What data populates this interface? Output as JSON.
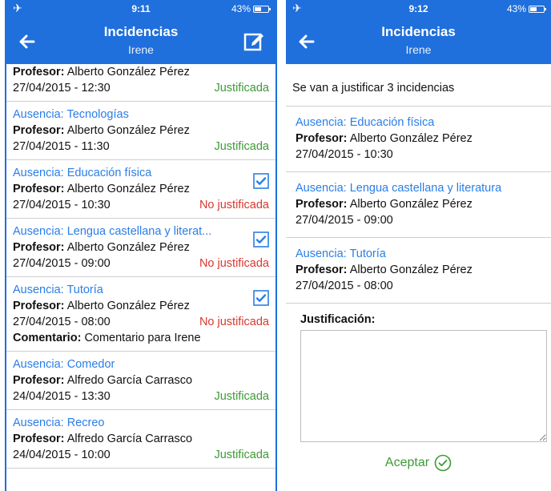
{
  "left": {
    "status": {
      "time": "9:11",
      "battery": "43%"
    },
    "header": {
      "title": "Incidencias",
      "subtitle": "Irene"
    },
    "partial_item": {
      "profesor_label": "Profesor:",
      "profesor": "Alberto González Pérez",
      "date": "27/04/2015 - 12:30",
      "status": "Justificada"
    },
    "items": [
      {
        "title": "Ausencia: Tecnologías",
        "profesor_label": "Profesor:",
        "profesor": "Alberto González Pérez",
        "date": "27/04/2015 - 11:30",
        "status": "Justificada"
      },
      {
        "title": "Ausencia: Educación física",
        "profesor_label": "Profesor:",
        "profesor": "Alberto González Pérez",
        "date": "27/04/2015 - 10:30",
        "status": "No justificada",
        "checked": true
      },
      {
        "title": "Ausencia: Lengua castellana y literat...",
        "profesor_label": "Profesor:",
        "profesor": "Alberto González Pérez",
        "date": "27/04/2015 - 09:00",
        "status": "No justificada",
        "checked": true
      },
      {
        "title": "Ausencia: Tutoría",
        "profesor_label": "Profesor:",
        "profesor": "Alberto González Pérez",
        "date": "27/04/2015 - 08:00",
        "status": "No justificada",
        "checked": true,
        "comment_label": "Comentario:",
        "comment": "Comentario para Irene"
      },
      {
        "title": "Ausencia: Comedor",
        "profesor_label": "Profesor:",
        "profesor": "Alfredo García Carrasco",
        "date": "24/04/2015 - 13:30",
        "status": "Justificada"
      },
      {
        "title": "Ausencia: Recreo",
        "profesor_label": "Profesor:",
        "profesor": "Alfredo García Carrasco",
        "date": "24/04/2015 - 10:00",
        "status": "Justificada"
      }
    ]
  },
  "right": {
    "status": {
      "time": "9:12",
      "battery": "43%"
    },
    "header": {
      "title": "Incidencias",
      "subtitle": "Irene"
    },
    "summary": "Se van a justificar 3 incidencias",
    "items": [
      {
        "title": "Ausencia: Educación física",
        "profesor_label": "Profesor:",
        "profesor": "Alberto González Pérez",
        "date": "27/04/2015 - 10:30"
      },
      {
        "title": "Ausencia: Lengua castellana y literatura",
        "profesor_label": "Profesor:",
        "profesor": "Alberto González Pérez",
        "date": "27/04/2015 - 09:00"
      },
      {
        "title": "Ausencia: Tutoría",
        "profesor_label": "Profesor:",
        "profesor": "Alberto González Pérez",
        "date": "27/04/2015 - 08:00"
      }
    ],
    "justification_label": "Justificación:",
    "justification_value": "",
    "accept_label": "Aceptar"
  },
  "colors": {
    "header": "#1f6fdc",
    "title": "#2a7ee7",
    "justified": "#3c9a35",
    "not_justified": "#d8382f"
  }
}
